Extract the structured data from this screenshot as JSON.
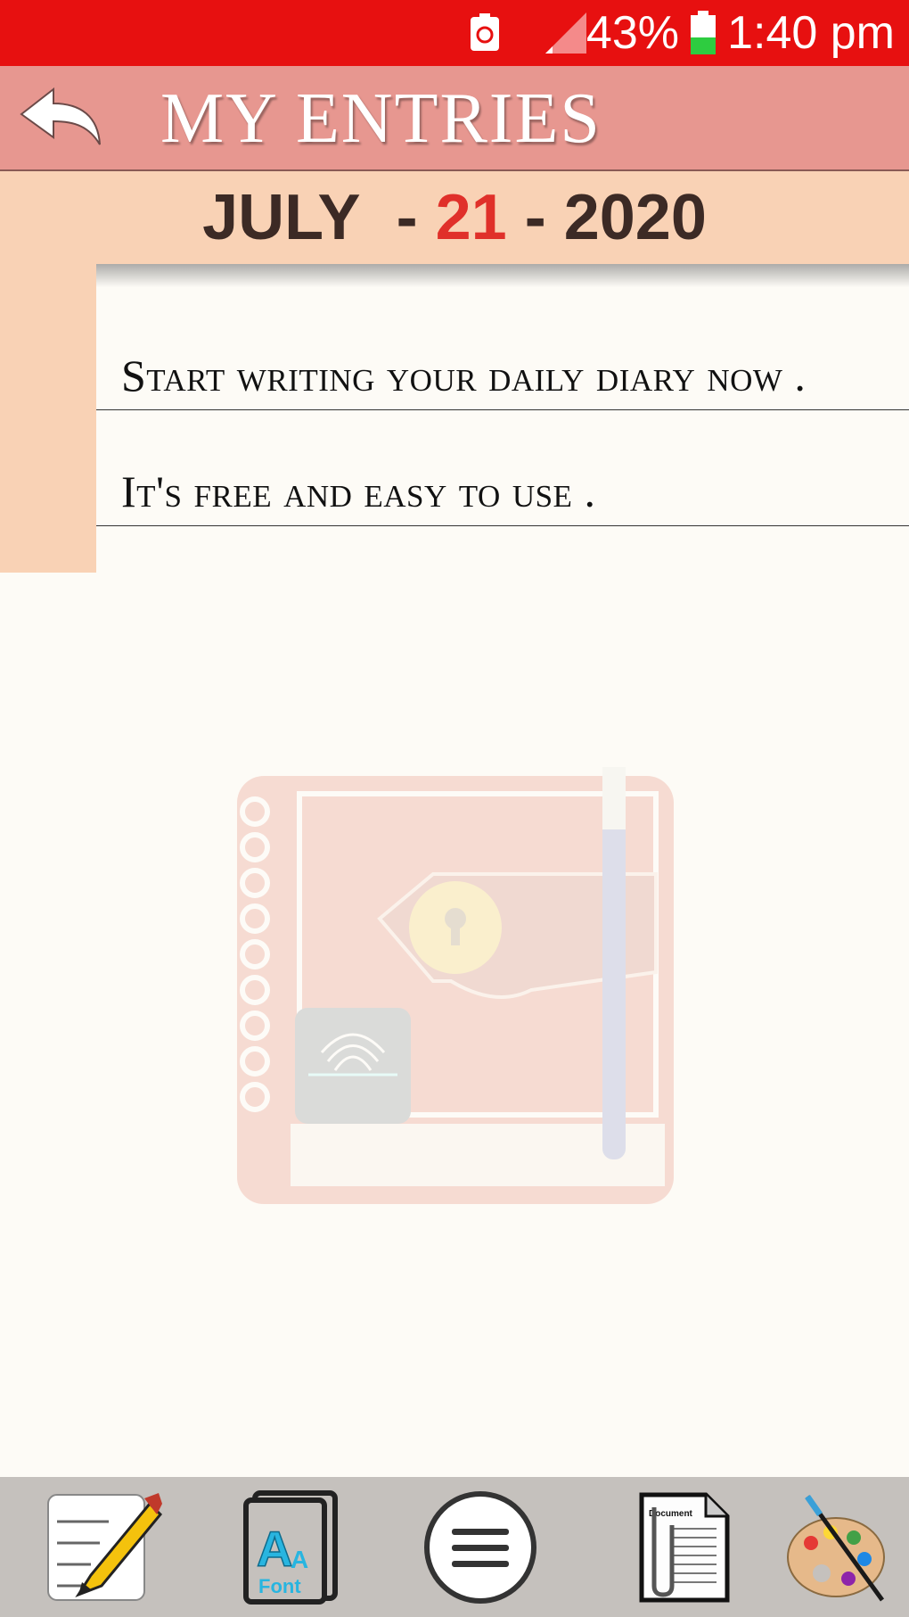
{
  "status_bar": {
    "battery_percent": "43%",
    "time": "1:40 pm",
    "icons": [
      "notification-icon",
      "signal-icon",
      "battery-icon"
    ]
  },
  "header": {
    "title": "MY ENTRIES",
    "back_icon": "back-arrow-icon"
  },
  "date": {
    "month": "JULY",
    "separator": "-",
    "day": "21",
    "year": "2020"
  },
  "entries": [
    "Start writing your  daily diary now .",
    "It's free and easy to use ."
  ],
  "watermark_icon": "diary-icon",
  "bottom_bar": {
    "items": [
      {
        "name": "write-entry-icon"
      },
      {
        "name": "font-icon",
        "label": "Font"
      },
      {
        "name": "menu-icon"
      },
      {
        "name": "document-icon",
        "label": "Document"
      },
      {
        "name": "palette-icon"
      }
    ]
  },
  "colors": {
    "status_bar": "#e71010",
    "header": "#e79790",
    "date_bar": "#f9d2b5",
    "date_day": "#e0302a",
    "page": "#fdfbf6",
    "bottom_bar": "#c5c1bd"
  }
}
